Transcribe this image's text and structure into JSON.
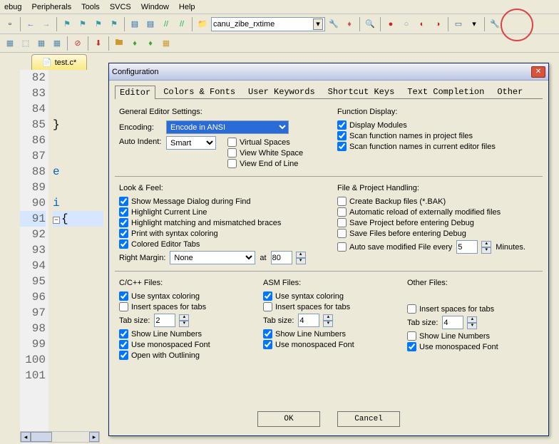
{
  "menu": [
    "ebug",
    "Peripherals",
    "Tools",
    "SVCS",
    "Window",
    "Help"
  ],
  "project_name": "canu_zibe_rxtime",
  "editor_tab": "test.c*",
  "line_numbers": [
    "82",
    "83",
    "84",
    "85",
    "86",
    "87",
    "88",
    "89",
    "90",
    "91",
    "92",
    "93",
    "94",
    "95",
    "96",
    "97",
    "98",
    "99",
    "100",
    "101"
  ],
  "code_frag": {
    "l85": "}",
    "l88": "e",
    "l90": "i",
    "l91": "{"
  },
  "dialog": {
    "title": "Configuration",
    "tabs": [
      "Editor",
      "Colors & Fonts",
      "User Keywords",
      "Shortcut Keys",
      "Text Completion",
      "Other"
    ],
    "general_heading": "General Editor Settings:",
    "encoding_label": "Encoding:",
    "encoding_value": "Encode in ANSI",
    "autoindent_label": "Auto Indent:",
    "autoindent_value": "Smart",
    "virtual_spaces": "Virtual Spaces",
    "view_whitespace": "View White Space",
    "view_eol": "View End of Line",
    "function_heading": "Function Display:",
    "disp_modules": "Display Modules",
    "scan_proj": "Scan function names in project files",
    "scan_curr": "Scan function names in current editor files",
    "look_heading": "Look & Feel:",
    "show_msg": "Show Message Dialog during Find",
    "hl_line": "Highlight Current Line",
    "hl_braces": "Highlight matching and mismatched braces",
    "print_syntax": "Print with syntax coloring",
    "colored_tabs": "Colored Editor Tabs",
    "right_margin_label": "Right Margin:",
    "right_margin_value": "None",
    "at_label": "at",
    "at_value": "80",
    "fph_heading": "File & Project Handling:",
    "create_backup": "Create Backup files (*.BAK)",
    "auto_reload": "Automatic reload of externally modified files",
    "save_proj": "Save Project before entering Debug",
    "save_files": "Save Files before entering Debug",
    "auto_save_pre": "Auto save modified File every",
    "auto_save_val": "5",
    "auto_save_post": "Minutes.",
    "ccpp_heading": "C/C++ Files:",
    "asm_heading": "ASM Files:",
    "other_heading": "Other Files:",
    "use_syntax": "Use syntax coloring",
    "insert_spaces": "Insert spaces for tabs",
    "tab_size_label": "Tab size:",
    "tab_c": "2",
    "tab_asm": "4",
    "tab_other": "4",
    "show_ln": "Show Line Numbers",
    "use_mono": "Use monospaced Font",
    "open_outline": "Open with Outlining",
    "ok": "OK",
    "cancel": "Cancel"
  }
}
